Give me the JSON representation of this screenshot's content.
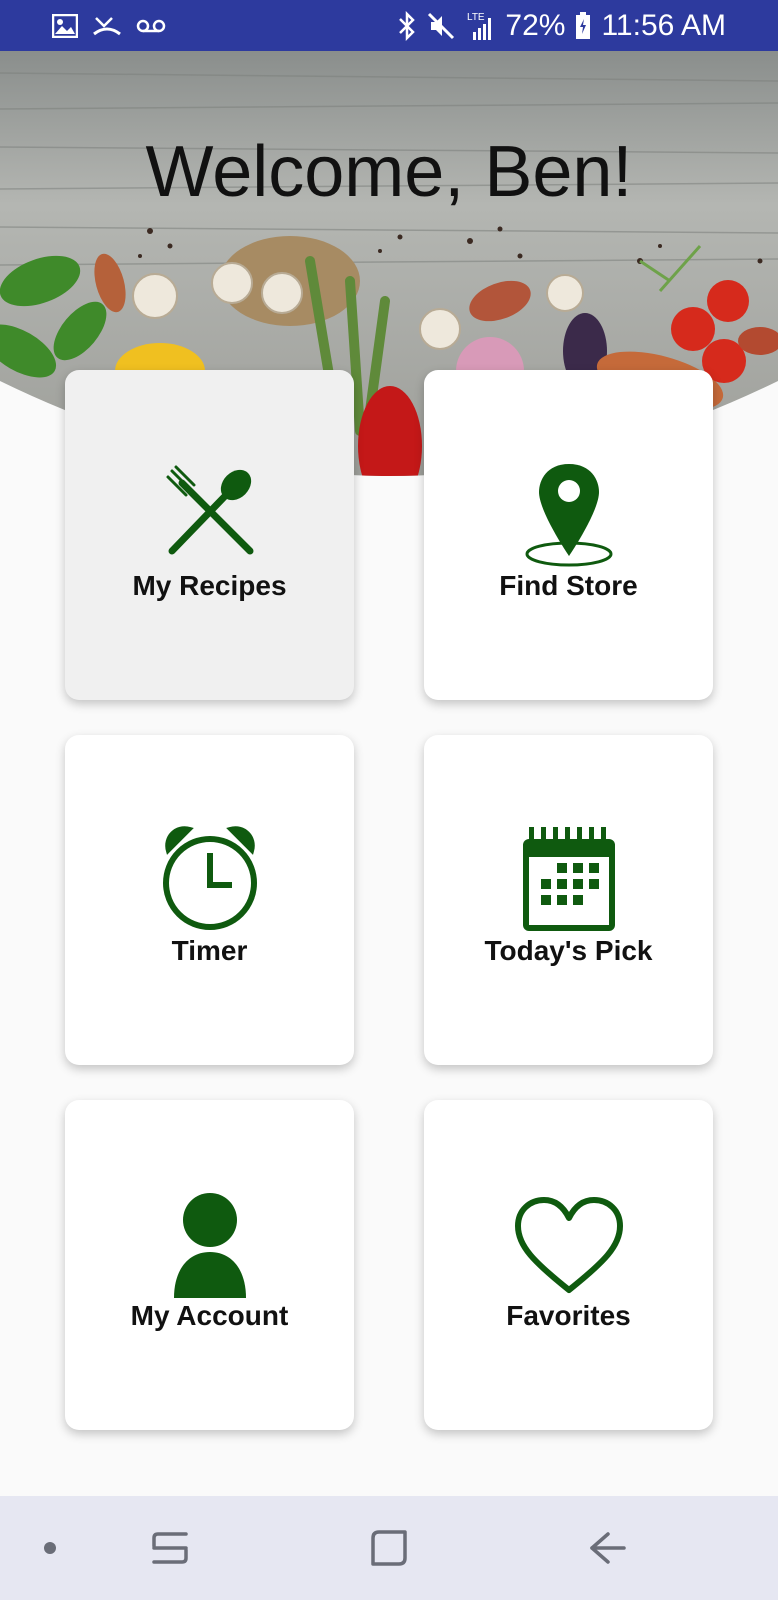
{
  "status_bar": {
    "left_icons": [
      "image-icon",
      "missed-call-icon",
      "voicemail-icon"
    ],
    "right_icons": [
      "bluetooth-icon",
      "mute-icon",
      "lte-signal-icon",
      "battery-icon"
    ],
    "network": "LTE",
    "battery": "72%",
    "time": "11:56 AM",
    "bg_color": "#2d3a9e"
  },
  "header": {
    "welcome": "Welcome, Ben!"
  },
  "tiles": [
    {
      "label": "My Recipes",
      "icon": "fork-spoon-icon"
    },
    {
      "label": "Find Store",
      "icon": "map-pin-icon"
    },
    {
      "label": "Timer",
      "icon": "alarm-clock-icon"
    },
    {
      "label": "Today's Pick",
      "icon": "calendar-icon"
    },
    {
      "label": "My Account",
      "icon": "person-icon"
    },
    {
      "label": "Favorites",
      "icon": "heart-icon"
    }
  ],
  "colors": {
    "accent_green": "#0f5a0f",
    "tile_bg": "#ffffff",
    "tile_pressed_bg": "#f0f0f0",
    "nav_bg": "#e6e7f2"
  },
  "nav_bar": {
    "buttons": [
      "dot-icon",
      "recents-icon",
      "home-icon",
      "back-icon"
    ]
  }
}
